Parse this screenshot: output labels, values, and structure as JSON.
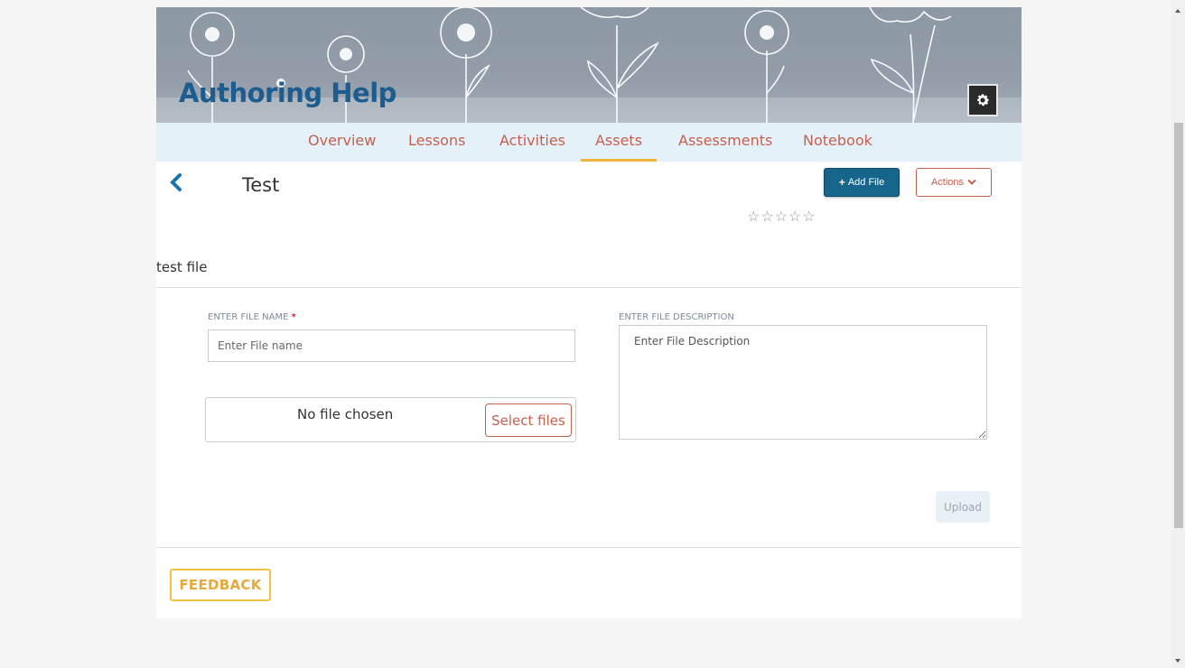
{
  "header": {
    "title": "Authoring Help",
    "settings_icon": "gear-icon"
  },
  "tabs": [
    {
      "label": "Overview",
      "active": false
    },
    {
      "label": "Lessons",
      "active": false
    },
    {
      "label": "Activities",
      "active": false
    },
    {
      "label": "Assets",
      "active": true
    },
    {
      "label": "Assessments",
      "active": false
    },
    {
      "label": "Notebook",
      "active": false
    }
  ],
  "asset": {
    "title": "Test",
    "add_file_label": "Add File",
    "actions_label": "Actions",
    "rating": "☆☆☆☆☆",
    "file_label": "test file"
  },
  "form": {
    "name_label": "ENTER FILE NAME",
    "required_mark": "*",
    "name_placeholder": "Enter File name",
    "desc_label": "ENTER FILE DESCRIPTION",
    "desc_placeholder": "Enter File Description",
    "no_file_text": "No file chosen",
    "select_files_label": "Select files",
    "upload_label": "Upload"
  },
  "footer": {
    "feedback_label": "FEEDBACK"
  },
  "colors": {
    "accent": "#c5604f",
    "primary": "#16658a",
    "active_tab_underline": "#f2b33d",
    "title": "#1d5c8f"
  }
}
